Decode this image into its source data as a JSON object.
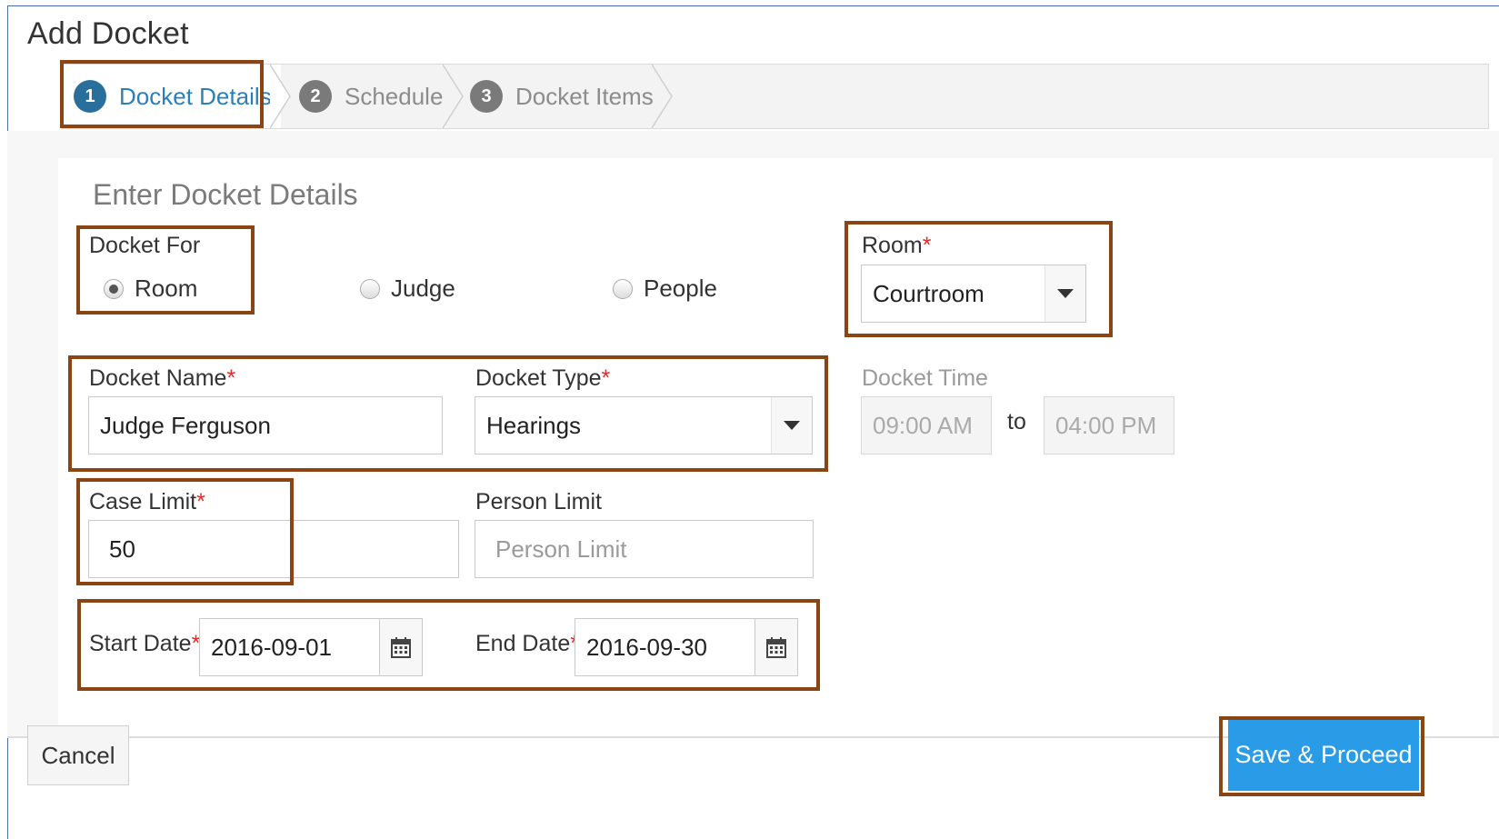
{
  "dialog": {
    "title": "Add Docket"
  },
  "wizard": {
    "steps": [
      {
        "number": "1",
        "label": "Docket Details"
      },
      {
        "number": "2",
        "label": "Schedule"
      },
      {
        "number": "3",
        "label": "Docket Items"
      }
    ]
  },
  "form": {
    "section_title": "Enter Docket Details",
    "docket_for": {
      "label": "Docket For",
      "options": [
        "Room",
        "Judge",
        "People"
      ],
      "selected": "Room"
    },
    "room": {
      "label": "Room",
      "value": "Courtroom"
    },
    "docket_name": {
      "label": "Docket Name",
      "value": "Judge Ferguson"
    },
    "docket_type": {
      "label": "Docket Type",
      "value": "Hearings"
    },
    "docket_time": {
      "label": "Docket Time",
      "from": "09:00 AM",
      "separator": "to",
      "to": "04:00 PM"
    },
    "case_limit": {
      "label": "Case Limit",
      "value": "50"
    },
    "person_limit": {
      "label": "Person Limit",
      "placeholder": "Person Limit"
    },
    "start_date": {
      "label": "Start Date",
      "value": "2016-09-01"
    },
    "end_date": {
      "label": "End Date",
      "value": "2016-09-30"
    },
    "required_mark": "*"
  },
  "footer": {
    "cancel_label": "Cancel",
    "save_label": "Save & Proceed"
  },
  "colors": {
    "highlight": "#8b4513",
    "primary": "#2a9be6",
    "required": "#e32b2b",
    "active_step": "#2c7fb8"
  }
}
